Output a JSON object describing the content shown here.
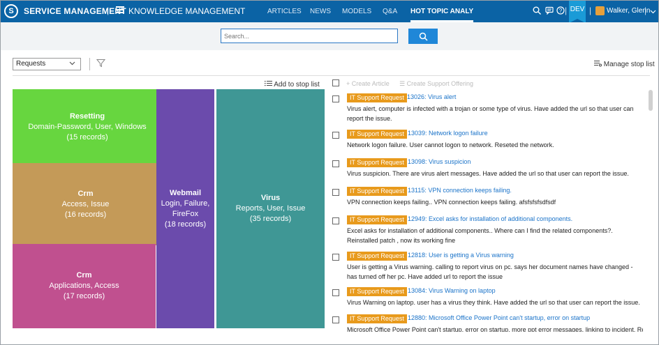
{
  "topbar": {
    "brand": "SERVICE MANAGEMENT",
    "separator": "|",
    "module": "KNOWLEDGE MANAGEMENT",
    "nav": [
      "ARTICLES",
      "NEWS",
      "MODELS",
      "Q&A",
      "HOT TOPIC ANALY"
    ],
    "active_nav": "HOT TOPIC ANALY",
    "dev_badge": "DEV",
    "user": "Walker, Glenn"
  },
  "search": {
    "placeholder": "Search..."
  },
  "toolbar": {
    "dropdown_value": "Requests",
    "manage_stop_list": "Manage stop list",
    "add_to_stop_list": "Add to stop list",
    "create_article": "Create Article",
    "create_support_offering": "Create Support Offering"
  },
  "treemap": [
    {
      "title": "Resetting",
      "keywords": "Domain-Password, User, Windows",
      "count": "(15 records)",
      "color": "#67d63f"
    },
    {
      "title": "Crm",
      "keywords": "Access, Issue",
      "count": "(16 records)",
      "color": "#c49a58"
    },
    {
      "title": "Crm",
      "keywords": "Applications, Access",
      "count": "(17 records)",
      "color": "#c0508f"
    },
    {
      "title": "Webmail",
      "keywords": "Login, Failure, FireFox",
      "count": "(18 records)",
      "color": "#6b4bac"
    },
    {
      "title": "Virus",
      "keywords": "Reports, User, Issue",
      "count": "(35 records)",
      "color": "#3f9795"
    }
  ],
  "items": [
    {
      "badge": "IT Support Request",
      "link": "13026:  Virus alert",
      "desc": "Virus alert, computer is infected with a trojan or some type of virus. Have added the url so that user can report the issue."
    },
    {
      "badge": "IT Support Request",
      "link": "13039:  Network logon failure",
      "desc": "Network logon failure. User cannot logon to network. Reseted the network."
    },
    {
      "badge": "IT Support Request",
      "link": "13098:  Virus suspicion",
      "desc": "Virus suspicion. There are virus alert messages. Have added the url so that user can report the issue."
    },
    {
      "badge": "IT Support Request",
      "link": "13115:  VPN connection keeps failing.",
      "desc": "VPN connection keeps failing.. VPN connection keeps failing. afsfsfsfsdfsdf"
    },
    {
      "badge": "IT Support Request",
      "link": "12949:  Excel asks for installation of additional components.",
      "desc": "Excel asks for installation of additional components.. Where can I find the related components?. Reinstalled patch , now its working fine"
    },
    {
      "badge": "IT Support Request",
      "link": "12818:  User is getting a Virus warning",
      "desc": "User is getting a Virus warning. calling to report virus on pc. says her document names have changed - has turned off her pc. Have added url to report the issue"
    },
    {
      "badge": "IT Support Request",
      "link": "13084:  Virus Warning on laptop",
      "desc": "Virus Warning on laptop. user has a virus they think. Have added the url so that user can report the issue."
    },
    {
      "badge": "IT Support Request",
      "link": "12880:  Microsoft Office Power Point can't startup, error on startup",
      "desc": "Microsoft Office Power Point can't startup, error on startup. more ppt error messages. linking to incident. Reinstalled"
    }
  ]
}
